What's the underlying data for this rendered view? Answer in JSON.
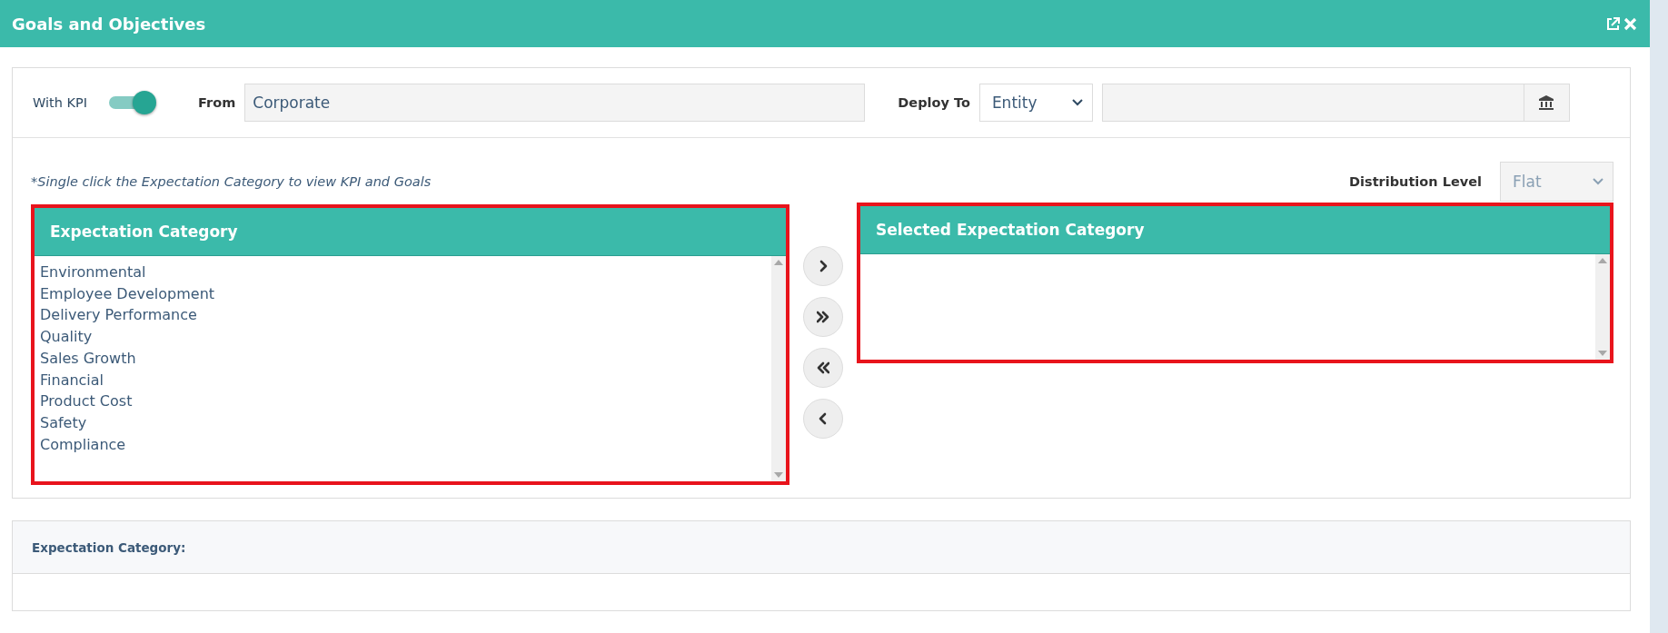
{
  "window": {
    "title": "Goals and Objectives"
  },
  "filters": {
    "with_kpi": {
      "label": "With KPI",
      "on": true
    },
    "from": {
      "label": "From",
      "value": "Corporate"
    },
    "deploy_to": {
      "label": "Deploy To",
      "value": "Entity"
    }
  },
  "hint": "*Single click the Expectation Category to view KPI and Goals",
  "distribution_level": {
    "label": "Distribution Level",
    "value": "Flat",
    "disabled": true
  },
  "available_panel": {
    "title": "Expectation Category",
    "highlighted": true,
    "items": [
      {
        "label": "Environmental"
      },
      {
        "label": "Employee Development"
      },
      {
        "label": "Delivery Performance"
      },
      {
        "label": "Quality"
      },
      {
        "label": "Sales Growth"
      },
      {
        "label": "Financial"
      },
      {
        "label": "Product Cost"
      },
      {
        "label": "Safety"
      },
      {
        "label": "Compliance"
      }
    ]
  },
  "selected_panel": {
    "title": "Selected Expectation Category",
    "highlighted": true
  },
  "detail_panel": {
    "title": "Expectation Category:"
  }
}
